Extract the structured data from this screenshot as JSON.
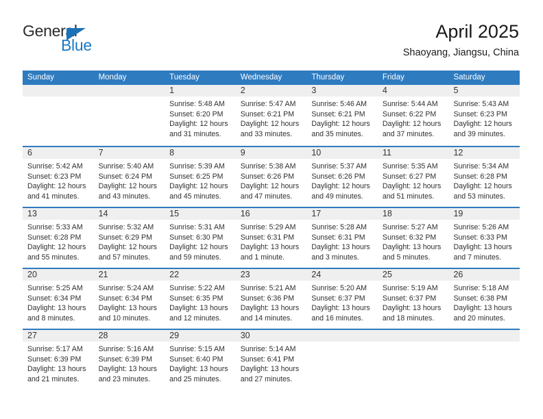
{
  "brand": {
    "name_top": "General",
    "name_bottom": "Blue",
    "triangle_icon": "triangle-icon",
    "accent_color": "#1b79c4"
  },
  "header": {
    "title": "April 2025",
    "subtitle": "Shaoyang, Jiangsu, China"
  },
  "theme": {
    "header_blue": "#2e7bc0",
    "numband_gray": "#efefef",
    "text_dark": "#2f2f2f"
  },
  "calendar": {
    "weekday_headers": [
      "Sunday",
      "Monday",
      "Tuesday",
      "Wednesday",
      "Thursday",
      "Friday",
      "Saturday"
    ],
    "weeks": [
      {
        "days": [
          {
            "date": "",
            "sunrise": "",
            "sunset": "",
            "daylight_1": "",
            "daylight_2": ""
          },
          {
            "date": "",
            "sunrise": "",
            "sunset": "",
            "daylight_1": "",
            "daylight_2": ""
          },
          {
            "date": "1",
            "sunrise": "Sunrise: 5:48 AM",
            "sunset": "Sunset: 6:20 PM",
            "daylight_1": "Daylight: 12 hours",
            "daylight_2": "and 31 minutes."
          },
          {
            "date": "2",
            "sunrise": "Sunrise: 5:47 AM",
            "sunset": "Sunset: 6:21 PM",
            "daylight_1": "Daylight: 12 hours",
            "daylight_2": "and 33 minutes."
          },
          {
            "date": "3",
            "sunrise": "Sunrise: 5:46 AM",
            "sunset": "Sunset: 6:21 PM",
            "daylight_1": "Daylight: 12 hours",
            "daylight_2": "and 35 minutes."
          },
          {
            "date": "4",
            "sunrise": "Sunrise: 5:44 AM",
            "sunset": "Sunset: 6:22 PM",
            "daylight_1": "Daylight: 12 hours",
            "daylight_2": "and 37 minutes."
          },
          {
            "date": "5",
            "sunrise": "Sunrise: 5:43 AM",
            "sunset": "Sunset: 6:23 PM",
            "daylight_1": "Daylight: 12 hours",
            "daylight_2": "and 39 minutes."
          }
        ]
      },
      {
        "days": [
          {
            "date": "6",
            "sunrise": "Sunrise: 5:42 AM",
            "sunset": "Sunset: 6:23 PM",
            "daylight_1": "Daylight: 12 hours",
            "daylight_2": "and 41 minutes."
          },
          {
            "date": "7",
            "sunrise": "Sunrise: 5:40 AM",
            "sunset": "Sunset: 6:24 PM",
            "daylight_1": "Daylight: 12 hours",
            "daylight_2": "and 43 minutes."
          },
          {
            "date": "8",
            "sunrise": "Sunrise: 5:39 AM",
            "sunset": "Sunset: 6:25 PM",
            "daylight_1": "Daylight: 12 hours",
            "daylight_2": "and 45 minutes."
          },
          {
            "date": "9",
            "sunrise": "Sunrise: 5:38 AM",
            "sunset": "Sunset: 6:26 PM",
            "daylight_1": "Daylight: 12 hours",
            "daylight_2": "and 47 minutes."
          },
          {
            "date": "10",
            "sunrise": "Sunrise: 5:37 AM",
            "sunset": "Sunset: 6:26 PM",
            "daylight_1": "Daylight: 12 hours",
            "daylight_2": "and 49 minutes."
          },
          {
            "date": "11",
            "sunrise": "Sunrise: 5:35 AM",
            "sunset": "Sunset: 6:27 PM",
            "daylight_1": "Daylight: 12 hours",
            "daylight_2": "and 51 minutes."
          },
          {
            "date": "12",
            "sunrise": "Sunrise: 5:34 AM",
            "sunset": "Sunset: 6:28 PM",
            "daylight_1": "Daylight: 12 hours",
            "daylight_2": "and 53 minutes."
          }
        ]
      },
      {
        "days": [
          {
            "date": "13",
            "sunrise": "Sunrise: 5:33 AM",
            "sunset": "Sunset: 6:28 PM",
            "daylight_1": "Daylight: 12 hours",
            "daylight_2": "and 55 minutes."
          },
          {
            "date": "14",
            "sunrise": "Sunrise: 5:32 AM",
            "sunset": "Sunset: 6:29 PM",
            "daylight_1": "Daylight: 12 hours",
            "daylight_2": "and 57 minutes."
          },
          {
            "date": "15",
            "sunrise": "Sunrise: 5:31 AM",
            "sunset": "Sunset: 6:30 PM",
            "daylight_1": "Daylight: 12 hours",
            "daylight_2": "and 59 minutes."
          },
          {
            "date": "16",
            "sunrise": "Sunrise: 5:29 AM",
            "sunset": "Sunset: 6:31 PM",
            "daylight_1": "Daylight: 13 hours",
            "daylight_2": "and 1 minute."
          },
          {
            "date": "17",
            "sunrise": "Sunrise: 5:28 AM",
            "sunset": "Sunset: 6:31 PM",
            "daylight_1": "Daylight: 13 hours",
            "daylight_2": "and 3 minutes."
          },
          {
            "date": "18",
            "sunrise": "Sunrise: 5:27 AM",
            "sunset": "Sunset: 6:32 PM",
            "daylight_1": "Daylight: 13 hours",
            "daylight_2": "and 5 minutes."
          },
          {
            "date": "19",
            "sunrise": "Sunrise: 5:26 AM",
            "sunset": "Sunset: 6:33 PM",
            "daylight_1": "Daylight: 13 hours",
            "daylight_2": "and 7 minutes."
          }
        ]
      },
      {
        "days": [
          {
            "date": "20",
            "sunrise": "Sunrise: 5:25 AM",
            "sunset": "Sunset: 6:34 PM",
            "daylight_1": "Daylight: 13 hours",
            "daylight_2": "and 8 minutes."
          },
          {
            "date": "21",
            "sunrise": "Sunrise: 5:24 AM",
            "sunset": "Sunset: 6:34 PM",
            "daylight_1": "Daylight: 13 hours",
            "daylight_2": "and 10 minutes."
          },
          {
            "date": "22",
            "sunrise": "Sunrise: 5:22 AM",
            "sunset": "Sunset: 6:35 PM",
            "daylight_1": "Daylight: 13 hours",
            "daylight_2": "and 12 minutes."
          },
          {
            "date": "23",
            "sunrise": "Sunrise: 5:21 AM",
            "sunset": "Sunset: 6:36 PM",
            "daylight_1": "Daylight: 13 hours",
            "daylight_2": "and 14 minutes."
          },
          {
            "date": "24",
            "sunrise": "Sunrise: 5:20 AM",
            "sunset": "Sunset: 6:37 PM",
            "daylight_1": "Daylight: 13 hours",
            "daylight_2": "and 16 minutes."
          },
          {
            "date": "25",
            "sunrise": "Sunrise: 5:19 AM",
            "sunset": "Sunset: 6:37 PM",
            "daylight_1": "Daylight: 13 hours",
            "daylight_2": "and 18 minutes."
          },
          {
            "date": "26",
            "sunrise": "Sunrise: 5:18 AM",
            "sunset": "Sunset: 6:38 PM",
            "daylight_1": "Daylight: 13 hours",
            "daylight_2": "and 20 minutes."
          }
        ]
      },
      {
        "days": [
          {
            "date": "27",
            "sunrise": "Sunrise: 5:17 AM",
            "sunset": "Sunset: 6:39 PM",
            "daylight_1": "Daylight: 13 hours",
            "daylight_2": "and 21 minutes."
          },
          {
            "date": "28",
            "sunrise": "Sunrise: 5:16 AM",
            "sunset": "Sunset: 6:39 PM",
            "daylight_1": "Daylight: 13 hours",
            "daylight_2": "and 23 minutes."
          },
          {
            "date": "29",
            "sunrise": "Sunrise: 5:15 AM",
            "sunset": "Sunset: 6:40 PM",
            "daylight_1": "Daylight: 13 hours",
            "daylight_2": "and 25 minutes."
          },
          {
            "date": "30",
            "sunrise": "Sunrise: 5:14 AM",
            "sunset": "Sunset: 6:41 PM",
            "daylight_1": "Daylight: 13 hours",
            "daylight_2": "and 27 minutes."
          },
          {
            "date": "",
            "sunrise": "",
            "sunset": "",
            "daylight_1": "",
            "daylight_2": ""
          },
          {
            "date": "",
            "sunrise": "",
            "sunset": "",
            "daylight_1": "",
            "daylight_2": ""
          },
          {
            "date": "",
            "sunrise": "",
            "sunset": "",
            "daylight_1": "",
            "daylight_2": ""
          }
        ]
      }
    ]
  }
}
